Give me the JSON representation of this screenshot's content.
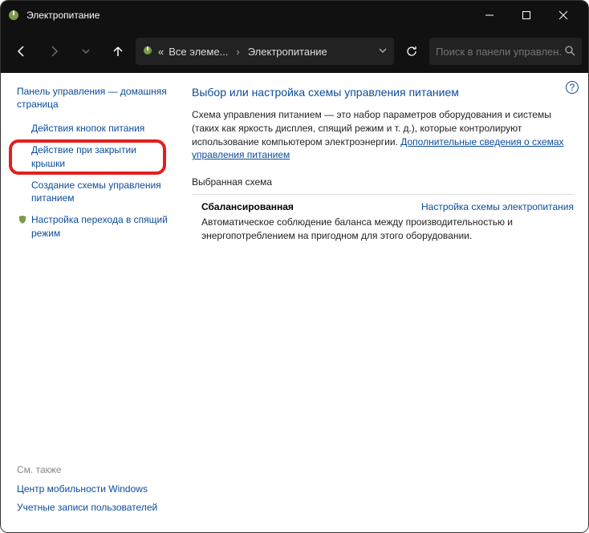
{
  "window": {
    "title": "Электропитание"
  },
  "breadcrumb": {
    "root_prefix": "«",
    "root": "Все элеме...",
    "current": "Электропитание"
  },
  "search": {
    "placeholder": "Поиск в панели управлен..."
  },
  "sidebar": {
    "home": "Панель управления — домашняя страница",
    "items": [
      {
        "label": "Действия кнопок питания"
      },
      {
        "label": "Действие при закрытии крышки"
      },
      {
        "label": "Создание схемы управления питанием"
      },
      {
        "label": "Настройка перехода в спящий режим"
      }
    ],
    "see_also": "См. также",
    "also_links": [
      "Центр мобильности Windows",
      "Учетные записи пользователей"
    ]
  },
  "main": {
    "heading": "Выбор или настройка схемы управления питанием",
    "desc_pre": "Схема управления питанием — это набор параметров оборудования и системы (таких как яркость дисплея, спящий режим и т. д.), которые контролируют использование компьютером электроэнергии. ",
    "desc_link": "Дополнительные сведения о схемах управления питанием",
    "selected_label": "Выбранная схема",
    "scheme_name": "Сбалансированная",
    "scheme_config": "Настройка схемы электропитания",
    "scheme_desc": "Автоматическое соблюдение баланса между производительностью и энергопотреблением на пригодном для этого оборудовании.",
    "help": "?"
  }
}
